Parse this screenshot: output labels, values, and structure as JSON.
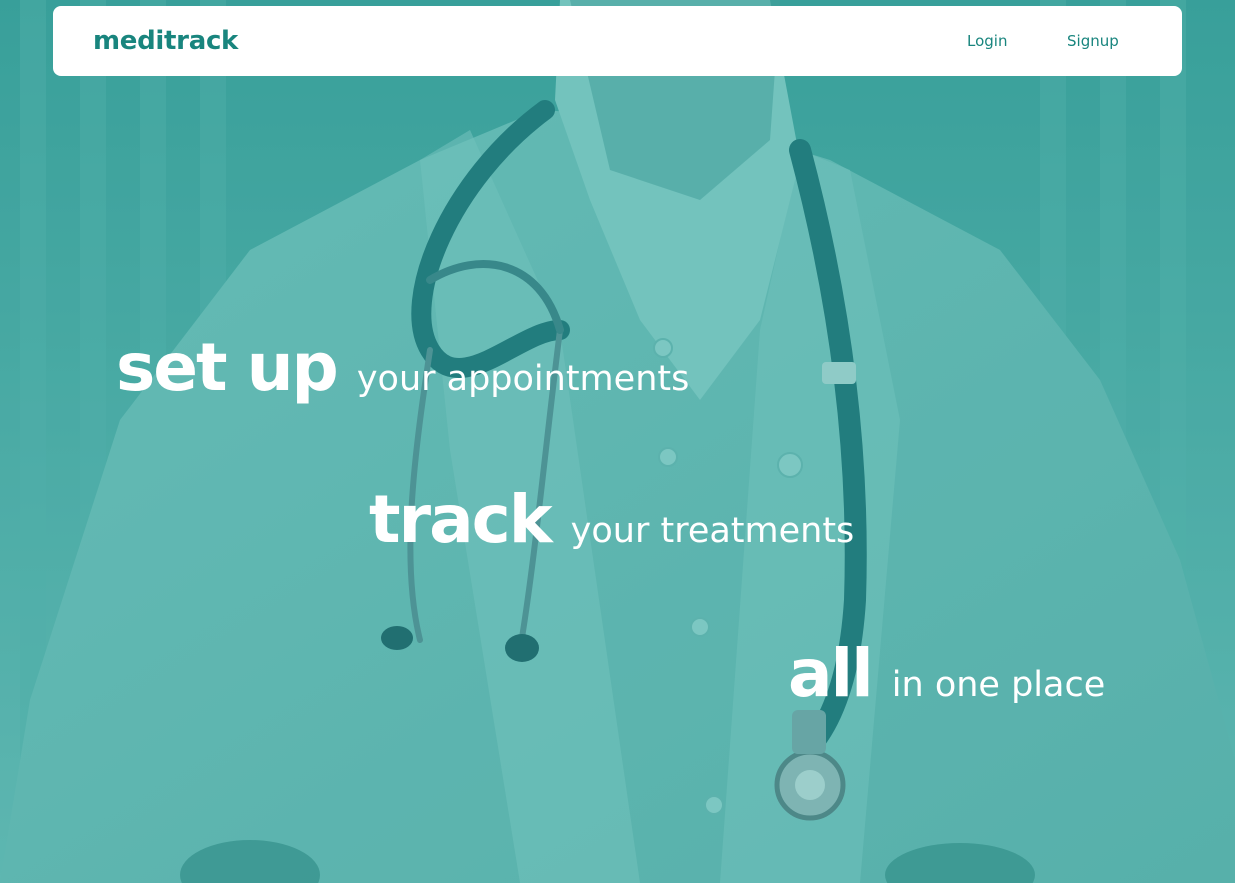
{
  "header": {
    "brand": "meditrack",
    "nav": {
      "login_label": "Login",
      "signup_label": "Signup"
    }
  },
  "hero": {
    "background": "doctor-with-stethoscope-photo",
    "lines": [
      {
        "emphasis": "set up",
        "rest": "your appointments"
      },
      {
        "emphasis": "track",
        "rest": "your treatments"
      },
      {
        "emphasis": "all",
        "rest": "in one place"
      }
    ]
  },
  "colors": {
    "brand_teal": "#19857e",
    "overlay_teal": "#4aa9a4",
    "navbar_bg": "#ffffff",
    "hero_text": "#ffffff"
  }
}
